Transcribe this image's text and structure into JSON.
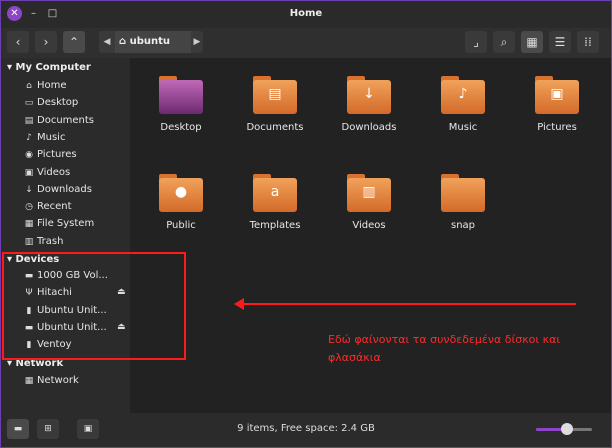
{
  "window": {
    "title": "Home"
  },
  "titlebar": {
    "close": "✕",
    "minimize": "–",
    "maximize": "□"
  },
  "toolbar": {
    "back": "‹",
    "forward": "›",
    "up": "⌃",
    "path_left": "◀",
    "path_right": "▶",
    "crumb": "ubuntu",
    "icons": [
      "open-terminal-icon",
      "search-icon",
      "grid-view-icon",
      "list-view-icon",
      "compact-view-icon"
    ]
  },
  "sidebar": {
    "my_computer": "▾ My Computer",
    "places": [
      {
        "icon": "⌂",
        "label": "Home"
      },
      {
        "icon": "▭",
        "label": "Desktop"
      },
      {
        "icon": "▤",
        "label": "Documents"
      },
      {
        "icon": "♪",
        "label": "Music"
      },
      {
        "icon": "◉",
        "label": "Pictures"
      },
      {
        "icon": "▣",
        "label": "Videos"
      },
      {
        "icon": "↓",
        "label": "Downloads"
      },
      {
        "icon": "◷",
        "label": "Recent"
      },
      {
        "icon": "▦",
        "label": "File System"
      },
      {
        "icon": "▥",
        "label": "Trash"
      }
    ],
    "devices": "▾ Devices",
    "device_items": [
      {
        "icon": "▬",
        "label": "1000 GB Vol...",
        "eject": ""
      },
      {
        "icon": "Ψ",
        "label": "Hitachi",
        "eject": "⏏"
      },
      {
        "icon": "▮",
        "label": "Ubuntu Unit...",
        "eject": ""
      },
      {
        "icon": "▬",
        "label": "Ubuntu Unit...",
        "eject": "⏏"
      },
      {
        "icon": "▮",
        "label": "Ventoy",
        "eject": ""
      }
    ],
    "network": "▾ Network",
    "network_items": [
      {
        "icon": "▦",
        "label": "Network"
      }
    ]
  },
  "files": [
    {
      "label": "Desktop",
      "sym": ""
    },
    {
      "label": "Documents",
      "sym": "▤"
    },
    {
      "label": "Downloads",
      "sym": "↓"
    },
    {
      "label": "Music",
      "sym": "♪"
    },
    {
      "label": "Pictures",
      "sym": "▣"
    },
    {
      "label": "Public",
      "sym": "●"
    },
    {
      "label": "Templates",
      "sym": "a"
    },
    {
      "label": "Videos",
      "sym": "▥"
    },
    {
      "label": "snap",
      "sym": ""
    }
  ],
  "statusbar": {
    "text": "9 items, Free space: 2.4 GB",
    "zoom_fraction": 0.55
  },
  "annotation": {
    "text_line1": "Εδώ φαίνονται τα συνδεδεμένα δίσκοι και",
    "text_line2": "φλασάκια"
  },
  "colors": {
    "accent": "#8e44c9",
    "folder": "#e88a40",
    "annotation": "#ff1a1a"
  }
}
